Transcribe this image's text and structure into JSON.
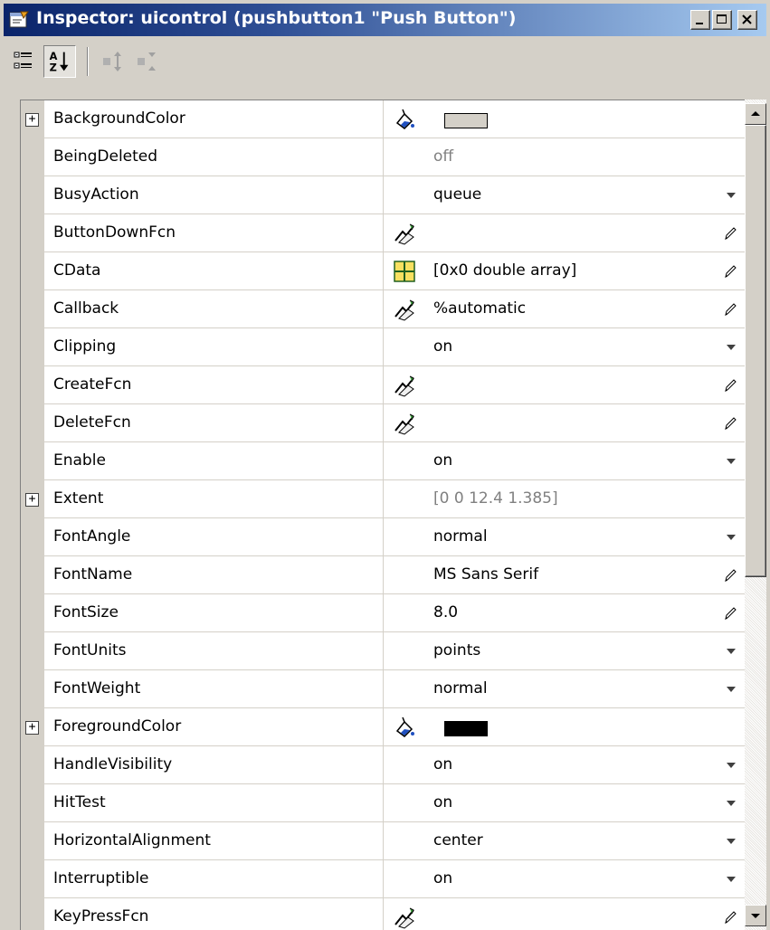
{
  "window": {
    "title": "Inspector:  uicontrol (pushbutton1 \"Push Button\")",
    "title_gradient_start": "#0a246a",
    "title_gradient_end": "#a6caf0",
    "caption_buttons": [
      "minimize-icon",
      "maximize-icon",
      "close-icon"
    ]
  },
  "toolbar": {
    "buttons": [
      {
        "icon": "categorized-view-icon",
        "pressed": false
      },
      {
        "icon": "sort-alphabetical-icon",
        "pressed": true
      },
      {
        "icon": "expand-all-icon",
        "pressed": false,
        "disabled": true
      },
      {
        "icon": "collapse-all-icon",
        "pressed": false,
        "disabled": true
      }
    ]
  },
  "properties": [
    {
      "name": "BackgroundColor",
      "expandable": true,
      "expander_label": "+",
      "button": "paint-bucket-icon",
      "color": "#d4d0c8",
      "editor": "none"
    },
    {
      "name": "BeingDeleted",
      "value": "off",
      "dim": true,
      "editor": "none"
    },
    {
      "name": "BusyAction",
      "value": "queue",
      "editor": "dropdown"
    },
    {
      "name": "ButtonDownFcn",
      "value": "",
      "button": "callback-hand-icon",
      "editor": "pencil"
    },
    {
      "name": "CData",
      "value": "[0x0  double array]",
      "button": "array-grid-icon",
      "editor": "pencil"
    },
    {
      "name": "Callback",
      "value": "%automatic",
      "button": "callback-hand-icon",
      "editor": "pencil"
    },
    {
      "name": "Clipping",
      "value": "on",
      "editor": "dropdown"
    },
    {
      "name": "CreateFcn",
      "value": "",
      "button": "callback-hand-icon",
      "editor": "pencil"
    },
    {
      "name": "DeleteFcn",
      "value": "",
      "button": "callback-hand-icon",
      "editor": "pencil"
    },
    {
      "name": "Enable",
      "value": "on",
      "editor": "dropdown"
    },
    {
      "name": "Extent",
      "value": "[0 0 12.4 1.385]",
      "dim": true,
      "expandable": true,
      "expander_label": "+",
      "editor": "none"
    },
    {
      "name": "FontAngle",
      "value": "normal",
      "editor": "dropdown"
    },
    {
      "name": "FontName",
      "value": "MS Sans Serif",
      "editor": "pencil"
    },
    {
      "name": "FontSize",
      "value": "8.0",
      "editor": "pencil"
    },
    {
      "name": "FontUnits",
      "value": "points",
      "editor": "dropdown"
    },
    {
      "name": "FontWeight",
      "value": "normal",
      "editor": "dropdown"
    },
    {
      "name": "ForegroundColor",
      "expandable": true,
      "expander_label": "+",
      "button": "paint-bucket-icon",
      "color": "#000000",
      "editor": "none"
    },
    {
      "name": "HandleVisibility",
      "value": "on",
      "editor": "dropdown"
    },
    {
      "name": "HitTest",
      "value": "on",
      "editor": "dropdown"
    },
    {
      "name": "HorizontalAlignment",
      "value": "center",
      "editor": "dropdown"
    },
    {
      "name": "Interruptible",
      "value": "on",
      "editor": "dropdown"
    },
    {
      "name": "KeyPressFcn",
      "value": "",
      "button": "callback-hand-icon",
      "editor": "pencil"
    }
  ]
}
